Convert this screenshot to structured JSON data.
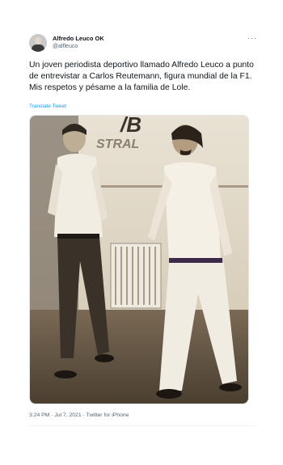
{
  "author": {
    "name": "Alfredo Leuco OK",
    "handle": "@alfleuco"
  },
  "tweet": {
    "text": "Un joven periodista deportivo llamado Alfredo Leuco a punto de entrevistar a Carlos Reutemann, figura mundial de la F1. Mis respetos y pésame a la familia de Lole.",
    "translate_label": "Translate Tweet",
    "more_label": "···"
  },
  "photo": {
    "background_lettering_line1": "/B",
    "background_lettering_line2": "STRAL"
  },
  "meta": {
    "time": "3:24 PM",
    "separator1": " · ",
    "date": "Jul 7, 2021",
    "separator2": " · ",
    "source": "Twitter for iPhone"
  },
  "colors": {
    "link": "#1d9bf0",
    "secondary_text": "#536471",
    "photo_sepia": "#d8cdb9"
  },
  "icons": {
    "avatar": "user-avatar",
    "more": "more-options-icon"
  }
}
